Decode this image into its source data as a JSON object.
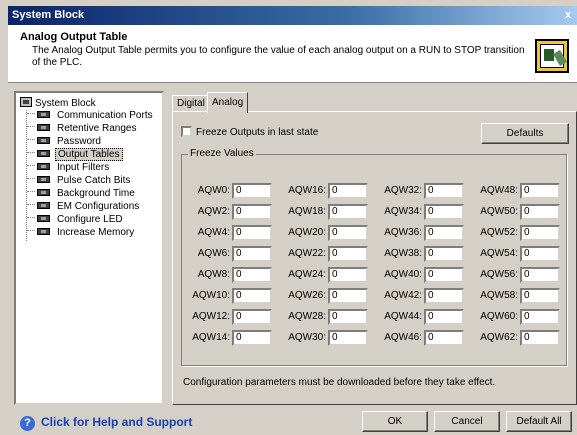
{
  "window": {
    "title": "System Block",
    "close_symbol": "x"
  },
  "header": {
    "title": "Analog Output Table",
    "description": "The Analog Output Table permits you to configure the value of each analog output on a RUN to STOP transition of the PLC.",
    "icon": "output-table-icon"
  },
  "tree": {
    "root": "System Block",
    "items": [
      "Communication Ports",
      "Retentive Ranges",
      "Password",
      "Output Tables",
      "Input Filters",
      "Pulse Catch Bits",
      "Background Time",
      "EM Configurations",
      "Configure LED",
      "Increase Memory"
    ],
    "selected": "Output Tables"
  },
  "tabs": [
    "Digital",
    "Analog"
  ],
  "active_tab": "Analog",
  "freeze": {
    "checkbox_label": "Freeze Outputs in last state",
    "checked": false,
    "defaults_button": "Defaults",
    "group_label": "Freeze Values"
  },
  "columns": [
    [
      {
        "label": "AQW0:",
        "value": "0"
      },
      {
        "label": "AQW2:",
        "value": "0"
      },
      {
        "label": "AQW4:",
        "value": "0"
      },
      {
        "label": "AQW6:",
        "value": "0"
      },
      {
        "label": "AQW8:",
        "value": "0"
      },
      {
        "label": "AQW10:",
        "value": "0"
      },
      {
        "label": "AQW12:",
        "value": "0"
      },
      {
        "label": "AQW14:",
        "value": "0"
      }
    ],
    [
      {
        "label": "AQW16:",
        "value": "0"
      },
      {
        "label": "AQW18:",
        "value": "0"
      },
      {
        "label": "AQW20:",
        "value": "0"
      },
      {
        "label": "AQW22:",
        "value": "0"
      },
      {
        "label": "AQW24:",
        "value": "0"
      },
      {
        "label": "AQW26:",
        "value": "0"
      },
      {
        "label": "AQW28:",
        "value": "0"
      },
      {
        "label": "AQW30:",
        "value": "0"
      }
    ],
    [
      {
        "label": "AQW32:",
        "value": "0"
      },
      {
        "label": "AQW34:",
        "value": "0"
      },
      {
        "label": "AQW36:",
        "value": "0"
      },
      {
        "label": "AQW38:",
        "value": "0"
      },
      {
        "label": "AQW40:",
        "value": "0"
      },
      {
        "label": "AQW42:",
        "value": "0"
      },
      {
        "label": "AQW44:",
        "value": "0"
      },
      {
        "label": "AQW46:",
        "value": "0"
      }
    ],
    [
      {
        "label": "AQW48:",
        "value": "0"
      },
      {
        "label": "AQW50:",
        "value": "0"
      },
      {
        "label": "AQW52:",
        "value": "0"
      },
      {
        "label": "AQW54:",
        "value": "0"
      },
      {
        "label": "AQW56:",
        "value": "0"
      },
      {
        "label": "AQW58:",
        "value": "0"
      },
      {
        "label": "AQW60:",
        "value": "0"
      },
      {
        "label": "AQW62:",
        "value": "0"
      }
    ]
  ],
  "note": "Configuration parameters must be downloaded before they take effect.",
  "footer": {
    "help": "Click for Help and Support",
    "ok": "OK",
    "cancel": "Cancel",
    "default_all": "Default All"
  }
}
